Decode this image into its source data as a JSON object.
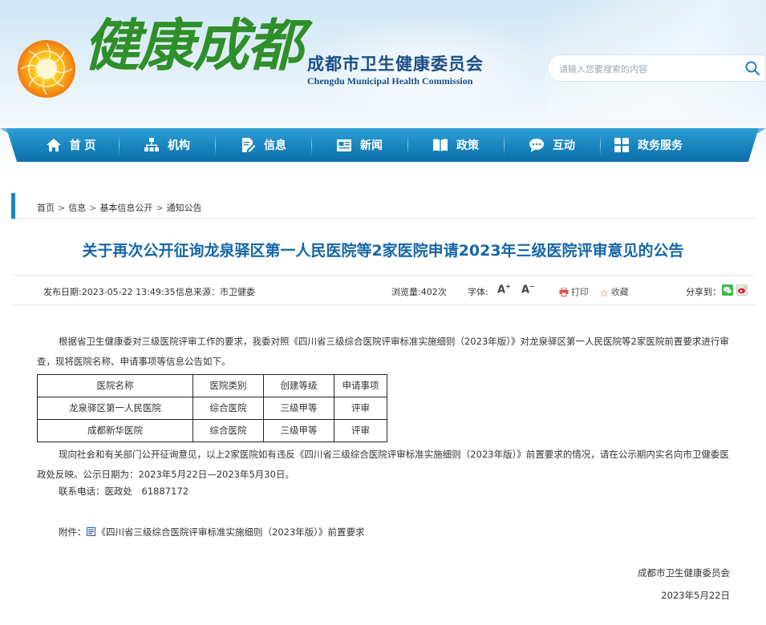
{
  "header": {
    "brand_cn": "健康成都",
    "org_cn": "成都市卫生健康委员会",
    "org_en": "Chengdu Municipal Health Commission",
    "search_placeholder": "请输入您要搜索的内容",
    "accent_color": "#1784bf",
    "brand_color": "#2f8f2a"
  },
  "nav": {
    "items": [
      {
        "label": "首 页",
        "icon": "home-icon"
      },
      {
        "label": "机构",
        "icon": "org-chart-icon"
      },
      {
        "label": "信息",
        "icon": "document-edit-icon"
      },
      {
        "label": "新闻",
        "icon": "newspaper-icon"
      },
      {
        "label": "政策",
        "icon": "book-icon"
      },
      {
        "label": "互动",
        "icon": "chat-icon"
      },
      {
        "label": "政务服务",
        "icon": "grid-icon"
      }
    ]
  },
  "breadcrumb": [
    "首页",
    "信息",
    "基本信息公开",
    "通知公告"
  ],
  "breadcrumb_sep": ">",
  "article": {
    "title": "关于再次公开征询龙泉驿区第一人民医院等2家医院申请2023年三级医院评审意见的公告",
    "meta": {
      "publish_date": "发布日期:2023-05-22 13:49:35",
      "source": "信息来源：市卫健委",
      "views": "浏览量:402次",
      "font_label": "字体:",
      "font_up": "A",
      "font_down": "A",
      "print": "打印",
      "favorite": "收藏",
      "share": "分享到："
    },
    "para1": "根据省卫生健康委对三级医院评审工作的要求，我委对照《四川省三级综合医院评审标准实施细则（2023年版）》对龙泉驿区第一人民医院等2家医院前置要求进行审查，现将医院名称、申请事项等信息公告如下。",
    "table": {
      "headers": [
        "医院名称",
        "医院类别",
        "创建等级",
        "申请事项"
      ],
      "rows": [
        [
          "龙泉驿区第一人民医院",
          "综合医院",
          "三级甲等",
          "评审"
        ],
        [
          "成都新华医院",
          "综合医院",
          "三级甲等",
          "评审"
        ]
      ]
    },
    "para2": "现向社会和有关部门公开征询意见，以上2家医院如有违反《四川省三级综合医院评审标准实施细则（2023年版）》前置要求的情况，请在公示期内实名向市卫健委医政处反映。公示日期为：2023年5月22日—2023年5月30日。",
    "contact": "联系电话：医政处　61887172",
    "attachment_label": "附件：",
    "attachment_link": "《四川省三级综合医院评审标准实施细则（2023年版）》前置要求",
    "sign_org": "成都市卫生健康委员会",
    "sign_date": "2023年5月22日"
  }
}
